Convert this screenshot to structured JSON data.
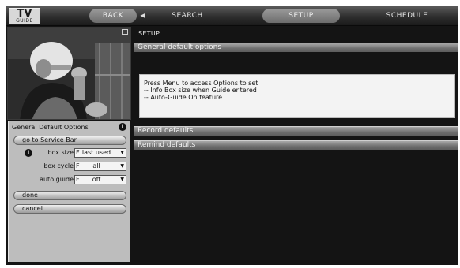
{
  "nav": {
    "logo_text": "TV",
    "logo_subtext": "GUIDE",
    "back_label": "BACK",
    "back_arrow": "◀",
    "search_label": "SEARCH",
    "setup_label": "SETUP",
    "schedule_label": "SCHEDULE"
  },
  "preview": {
    "lock_icon": "lock-icon",
    "description_hidden": ""
  },
  "left_panel": {
    "title": "General Default Options",
    "info_icon": "i",
    "go_to_service_bar_label": "go to Service Bar",
    "box_size": {
      "label": "box size",
      "prefix": "F",
      "value": "last used"
    },
    "box_cycle": {
      "label": "box cycle",
      "prefix": "F",
      "value": "all"
    },
    "auto_guide": {
      "label": "auto guide",
      "prefix": "F",
      "value": "off"
    },
    "done_label": "done",
    "cancel_label": "cancel"
  },
  "content": {
    "breadcrumb": "SETUP",
    "general_header": "General default options",
    "info_lines": [
      "Press Menu to access Options to set",
      "-- Info Box size when Guide entered",
      "-- Auto-Guide On feature"
    ],
    "record_header": "Record defaults",
    "remind_header": "Remind defaults"
  }
}
